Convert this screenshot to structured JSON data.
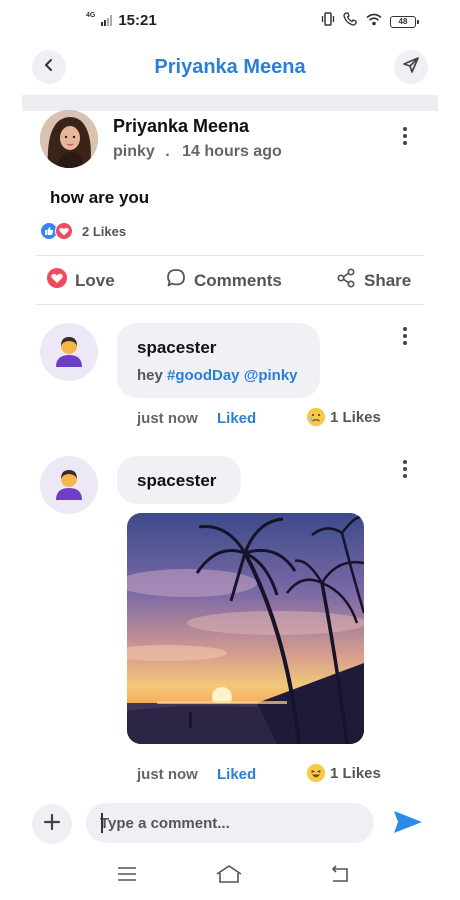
{
  "status_bar": {
    "network_label": "4G",
    "time": "15:21",
    "battery": "48"
  },
  "header": {
    "title": "Priyanka Meena",
    "accent_color": "#2b7fd8"
  },
  "post": {
    "author": "Priyanka Meena",
    "username": "pinky",
    "separator": ".",
    "time_ago": "14 hours ago",
    "text": "how are you",
    "likes_label": "2 Likes"
  },
  "actions": {
    "love": "Love",
    "comments": "Comments",
    "share": "Share"
  },
  "comments": [
    {
      "name": "spacester",
      "text_plain": "hey ",
      "tags": [
        "#goodDay",
        "@pinky"
      ],
      "time": "just now",
      "liked_label": "Liked",
      "reaction_likes": "1 Likes"
    },
    {
      "name": "spacester",
      "has_image": true,
      "time": "just now",
      "liked_label": "Liked",
      "reaction_likes": "1 Likes"
    }
  ],
  "composer": {
    "placeholder": "Type a comment..."
  },
  "icons": {
    "back": "chevron-left-icon",
    "send_top": "paper-plane-icon",
    "more": "more-vertical-icon",
    "love": "heart-icon",
    "comments": "speech-bubble-icon",
    "share": "share-icon",
    "add": "plus-icon",
    "send": "send-arrow-icon",
    "nav_menu": "menu-icon",
    "nav_home": "home-icon",
    "nav_back": "back-icon"
  }
}
